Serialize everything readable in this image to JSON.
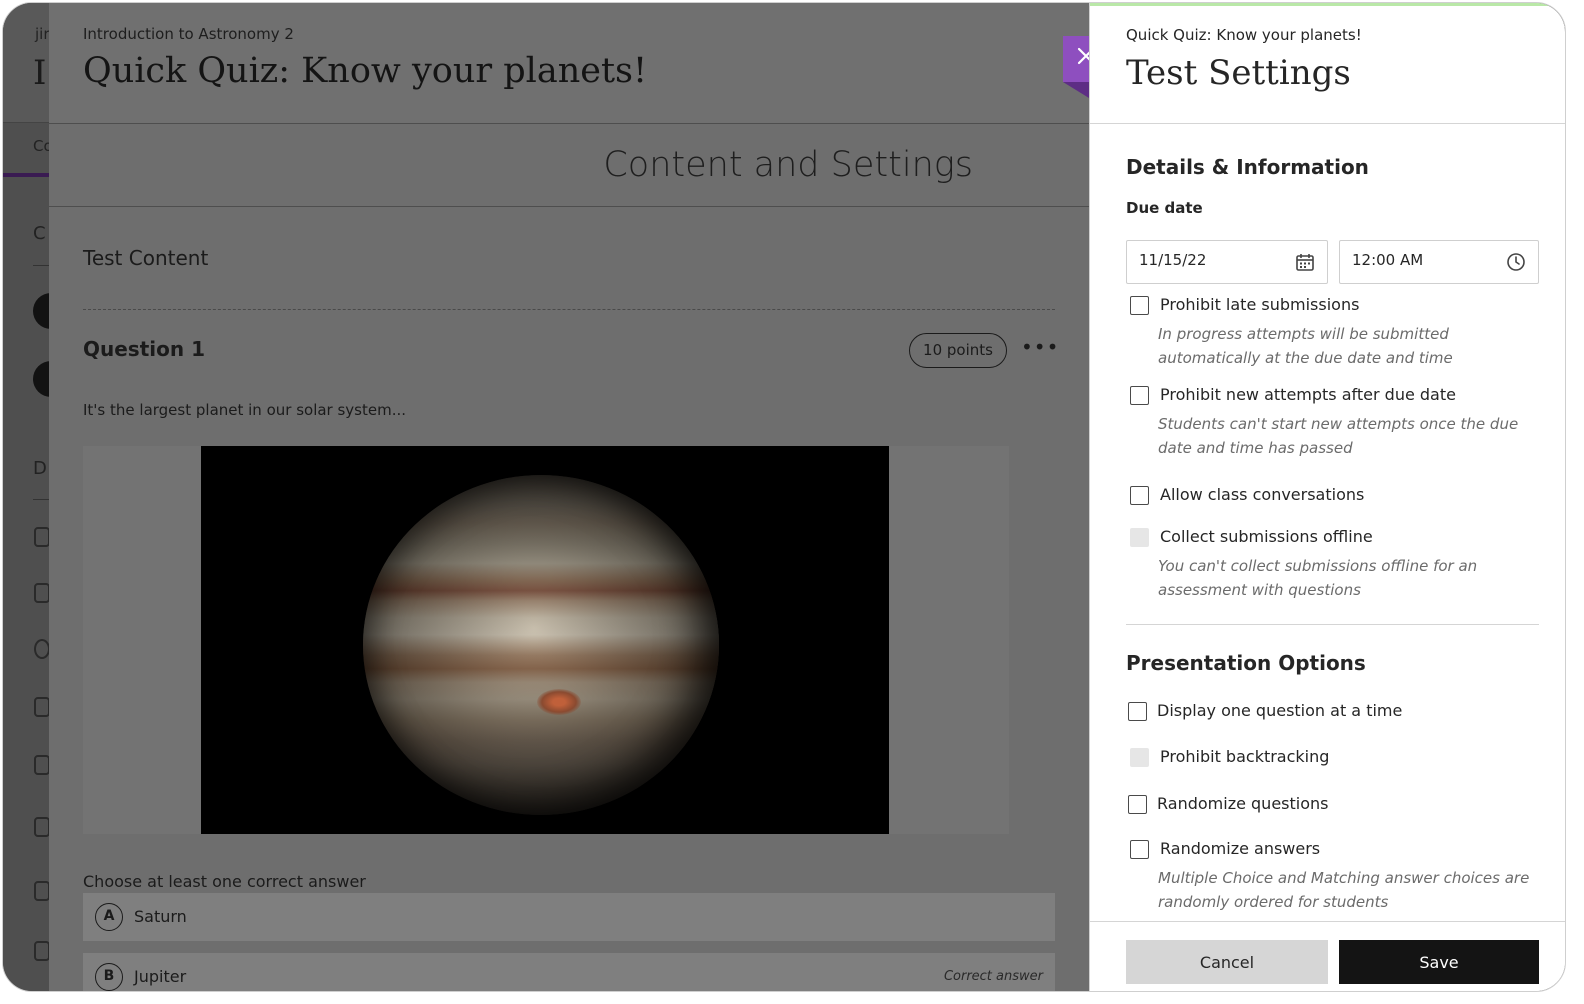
{
  "back": {
    "crumb": "jir",
    "title": "I",
    "tab": "Co",
    "section": "C",
    "letter": "D"
  },
  "main": {
    "course": "Introduction to Astronomy 2",
    "quiz_title": "Quick Quiz: Know your planets!",
    "section_title": "Content and Settings",
    "test_content": "Test Content",
    "question_label": "Question 1",
    "points": "10 points",
    "more_icon": "ellipsis-icon",
    "prompt": "It's the largest planet in our solar system...",
    "image_subject": "Jupiter",
    "choose_text": "Choose at least one correct answer",
    "answers": [
      {
        "letter": "A",
        "text": "Saturn",
        "note": ""
      },
      {
        "letter": "B",
        "text": "Jupiter",
        "note": "Correct answer"
      }
    ]
  },
  "close_icon": "close-icon",
  "colors": {
    "accent_purple": "#8e4fbf",
    "save_button": "#141414",
    "cancel_button": "#d6d6d6"
  },
  "panel": {
    "subtitle": "Quick Quiz: Know your planets!",
    "title": "Test Settings",
    "details_heading": "Details & Information",
    "due_date_label": "Due date",
    "due_date_value": "11/15/22",
    "due_time_value": "12:00 AM",
    "date_icon": "calendar-icon",
    "time_icon": "clock-icon",
    "details_options": [
      {
        "label": "Prohibit late submissions",
        "help": "In progress attempts will be submitted automatically at the due date and time",
        "checked": false,
        "disabled": false
      },
      {
        "label": "Prohibit new attempts after due date",
        "help": "Students can't start new attempts once the due date and time has passed",
        "checked": false,
        "disabled": false
      },
      {
        "label": "Allow class conversations",
        "help": "",
        "checked": false,
        "disabled": false
      },
      {
        "label": "Collect submissions offline",
        "help": "You can't collect submissions offline for an assessment with questions",
        "checked": false,
        "disabled": true
      }
    ],
    "presentation_heading": "Presentation Options",
    "presentation_options": [
      {
        "label": "Display one question at a time",
        "help": "",
        "checked": false,
        "disabled": false
      },
      {
        "label": "Prohibit backtracking",
        "help": "",
        "checked": false,
        "disabled": true
      },
      {
        "label": "Randomize questions",
        "help": "",
        "checked": false,
        "disabled": false
      },
      {
        "label": "Randomize answers",
        "help": "Multiple Choice and Matching answer choices are randomly ordered for students",
        "checked": false,
        "disabled": false
      }
    ],
    "cancel_label": "Cancel",
    "save_label": "Save"
  }
}
